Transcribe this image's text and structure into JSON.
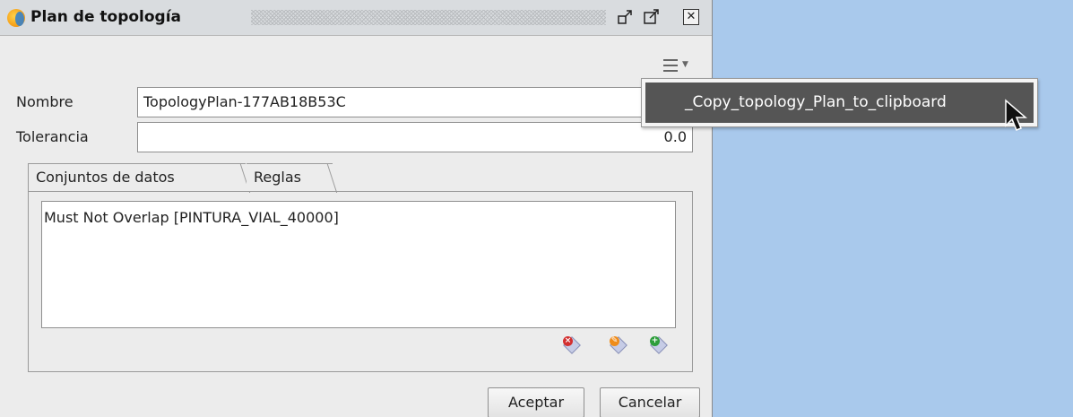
{
  "window": {
    "title": "Plan de topología",
    "icons": [
      "app-icon",
      "restore-icon",
      "maximize-icon",
      "close-icon",
      "menu-icon"
    ]
  },
  "form": {
    "name_label": "Nombre",
    "name_value": "TopologyPlan-177AB18B53C",
    "tolerance_label": "Tolerancia",
    "tolerance_value": "0.0"
  },
  "tabs": [
    {
      "label": "Conjuntos de datos",
      "selected": false
    },
    {
      "label": "Reglas",
      "selected": true
    }
  ],
  "rules": {
    "items": [
      "Must Not Overlap [PINTURA_VIAL_40000]"
    ],
    "buttons": [
      "remove-rule-icon",
      "edit-rule-icon",
      "add-rule-icon"
    ]
  },
  "footer": {
    "ok_label": "Aceptar",
    "cancel_label": "Cancelar"
  },
  "popup_menu": {
    "item_label": "_Copy_topology_Plan_to_clipboard"
  },
  "colors": {
    "desktop_background": "#a9c9ec",
    "window_background": "#ececec",
    "menu_highlight": "#555555"
  }
}
